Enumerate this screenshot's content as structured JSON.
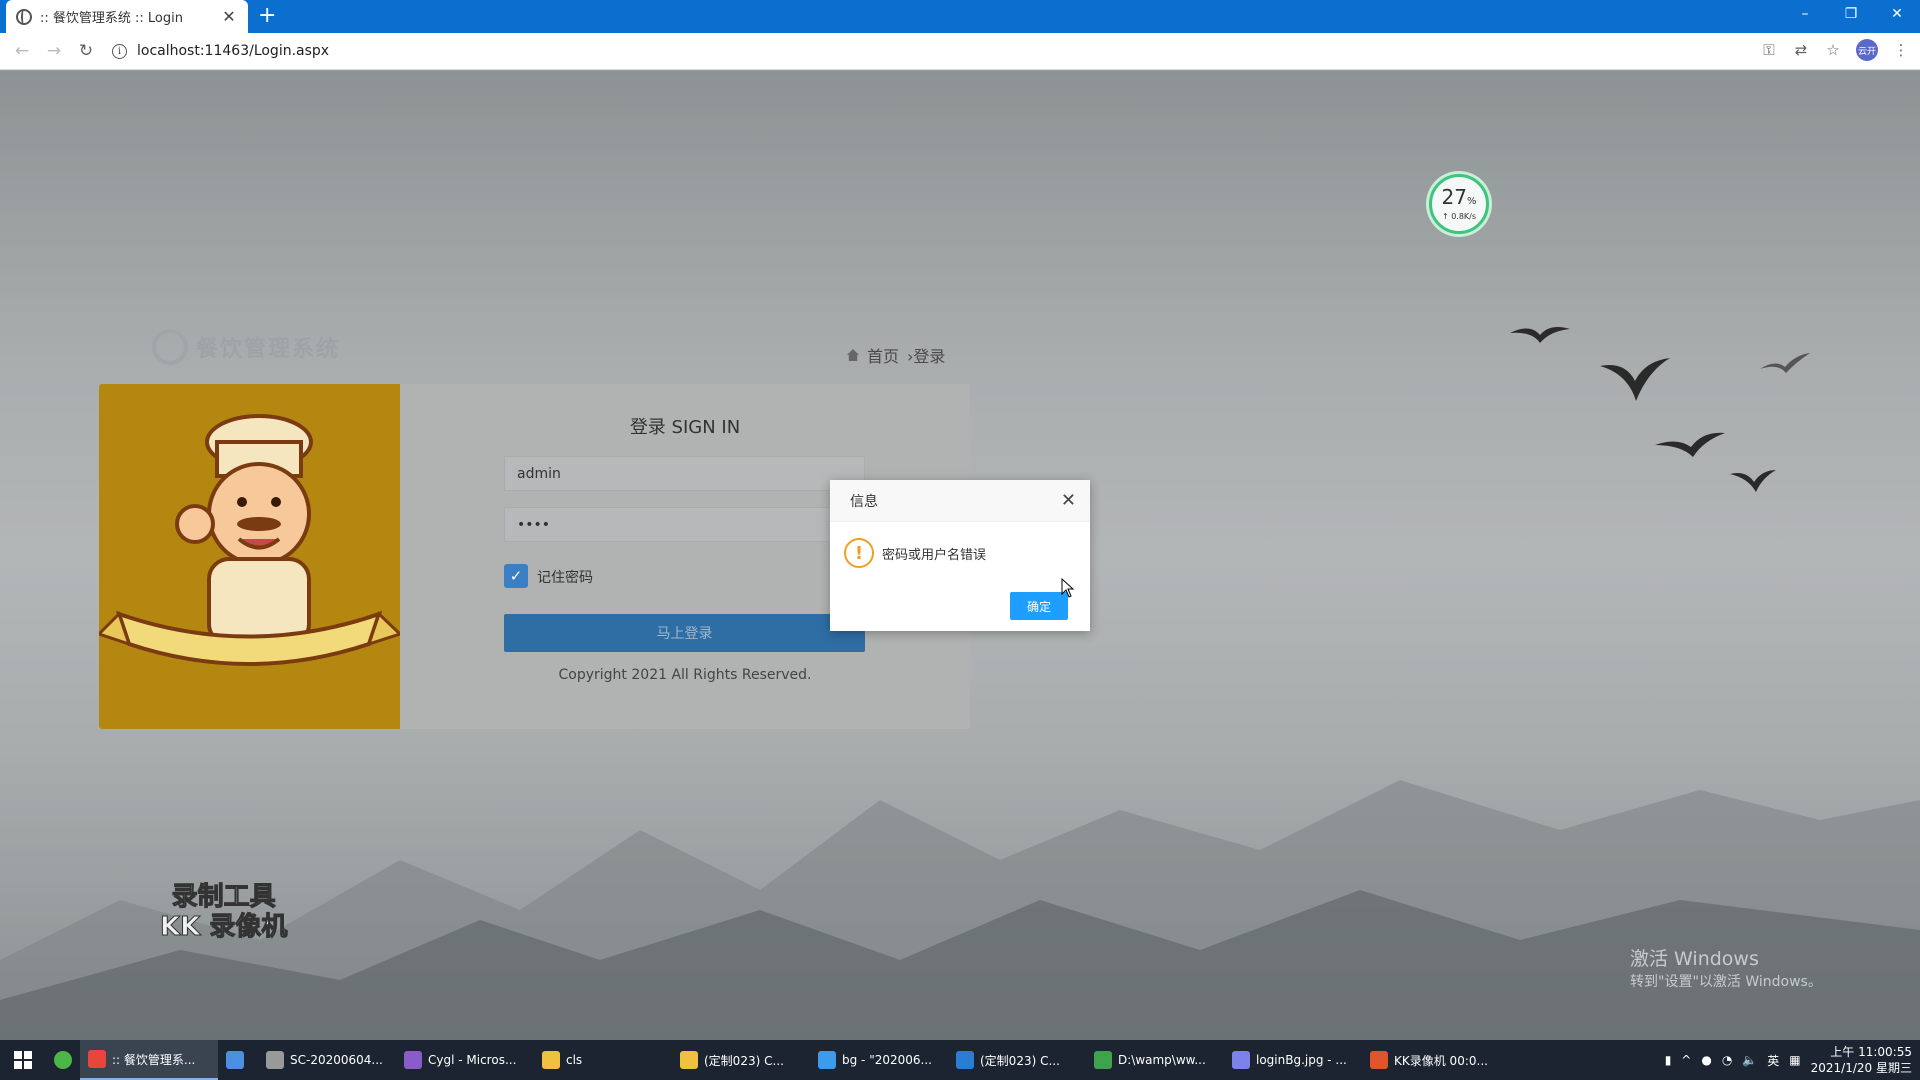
{
  "browser": {
    "tab_title": ":: 餐饮管理系统 :: Login",
    "new_tab": "+",
    "url": "localhost:11463/Login.aspx",
    "window_controls": [
      "–",
      "❐",
      "✕"
    ],
    "profile_label": "云开"
  },
  "speed_widget": {
    "percent": "27",
    "percent_unit": "%",
    "rate": "↑ 0.8K/s"
  },
  "site": {
    "logo_text": "餐饮管理系统",
    "breadcrumb": {
      "home": "首页",
      "current": "›登录"
    }
  },
  "login": {
    "title": "登录 SIGN IN",
    "username_value": "admin",
    "password_value": "••••",
    "remember_label": "记住密码",
    "remember_checked": true,
    "submit_label": "马上登录",
    "copyright": "Copyright 2021 All Rights Reserved."
  },
  "dialog": {
    "title": "信息",
    "message": "密码或用户名错误",
    "ok_label": "确定",
    "close": "✕"
  },
  "watermark": {
    "line1": "录制工具",
    "line2": "KK 录像机"
  },
  "activation": {
    "line1": "激活 Windows",
    "line2": "转到\"设置\"以激活 Windows。"
  },
  "taskbar": {
    "items": [
      {
        "label": ":: 餐饮管理系...",
        "color": "#e8453c",
        "active": true
      },
      {
        "label": "",
        "color": "#4a8fe0",
        "active": false
      },
      {
        "label": "SC-20200604...",
        "color": "#999999",
        "active": false
      },
      {
        "label": "Cygl - Micros...",
        "color": "#8a5cc9",
        "active": false
      },
      {
        "label": "cls",
        "color": "#f0c040",
        "active": false
      },
      {
        "label": "(定制023) C...",
        "color": "#f0c040",
        "active": false
      },
      {
        "label": "bg - \"202006...",
        "color": "#3d9be9",
        "active": false
      },
      {
        "label": "(定制023) C...",
        "color": "#2b7cd3",
        "active": false
      },
      {
        "label": "D:\\wamp\\ww...",
        "color": "#3fa34d",
        "active": false
      },
      {
        "label": "loginBg.jpg - ...",
        "color": "#7b83eb",
        "active": false
      },
      {
        "label": "KK录像机 00:0...",
        "color": "#e0552b",
        "active": false
      }
    ],
    "ime": "英",
    "time": "上午 11:00:55",
    "date": "2021/1/20 星期三"
  }
}
